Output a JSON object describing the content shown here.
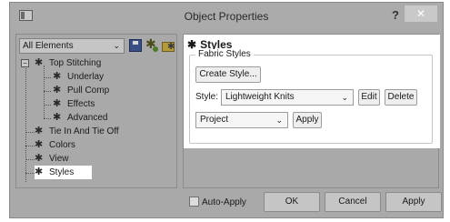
{
  "window": {
    "title": "Object Properties",
    "help_label": "?",
    "close_label": "✕"
  },
  "left_panel": {
    "filter_value": "All Elements",
    "tree": {
      "root": "Top Stitching",
      "root_expander": "−",
      "children": [
        "Underlay",
        "Pull Comp",
        "Effects",
        "Advanced"
      ],
      "siblings": [
        "Tie In And Tie Off",
        "Colors",
        "View",
        "Styles"
      ],
      "selected": "Styles"
    }
  },
  "right_panel": {
    "header": "Styles",
    "group_title": "Fabric Styles",
    "create_style_label": "Create Style...",
    "style_label": "Style:",
    "style_value": "Lightweight Knits",
    "edit_label": "Edit",
    "delete_label": "Delete",
    "scope_value": "Project",
    "apply_small_label": "Apply"
  },
  "footer": {
    "auto_apply_label": "Auto-Apply",
    "auto_apply_checked": false,
    "ok_label": "OK",
    "cancel_label": "Cancel",
    "apply_label": "Apply"
  }
}
